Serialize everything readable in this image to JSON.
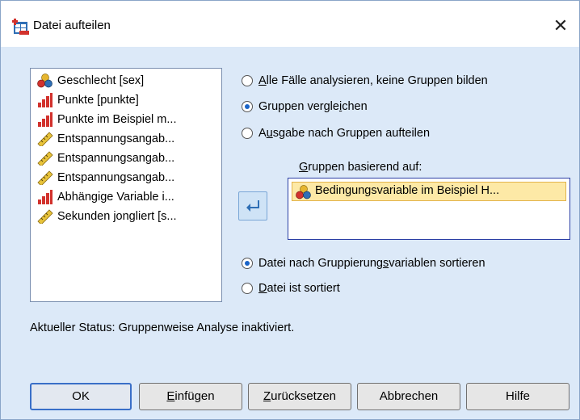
{
  "window": {
    "title": "Datei aufteilen",
    "close_glyph": "✕"
  },
  "variables": [
    {
      "label": "Geschlecht [sex]",
      "icon": "nominal-icon"
    },
    {
      "label": "Punkte [punkte]",
      "icon": "scale-icon"
    },
    {
      "label": "Punkte im Beispiel m...",
      "icon": "scale-icon"
    },
    {
      "label": "Entspannungsangab...",
      "icon": "ordinal-ruler-icon"
    },
    {
      "label": "Entspannungsangab...",
      "icon": "ordinal-ruler-icon"
    },
    {
      "label": "Entspannungsangab...",
      "icon": "ordinal-ruler-icon"
    },
    {
      "label": "Abhängige Variable i...",
      "icon": "scale-icon"
    },
    {
      "label": "Sekunden jongliert [s...",
      "icon": "ordinal-ruler-icon"
    }
  ],
  "analysis_options": [
    {
      "pre": "",
      "ul": "A",
      "post": "lle Fälle analysieren, keine Gruppen bilden",
      "selected": false
    },
    {
      "pre": "Gruppen vergle",
      "ul": "i",
      "post": "chen",
      "selected": true
    },
    {
      "pre": "A",
      "ul": "u",
      "post": "sgabe nach Gruppen aufteilen",
      "selected": false
    }
  ],
  "groups": {
    "label_ul": "G",
    "label_rest": "ruppen basierend auf:",
    "items": [
      {
        "label": "Bedingungsvariable im Beispiel H...",
        "icon": "nominal-icon"
      }
    ]
  },
  "sort_options": [
    {
      "pre": "Datei nach Gruppierung",
      "ul": "s",
      "post": "variablen sortieren",
      "selected": true
    },
    {
      "pre": "",
      "ul": "D",
      "post": "atei ist sortiert",
      "selected": false
    }
  ],
  "status": "Aktueller Status: Gruppenweise Analyse inaktiviert.",
  "buttons": {
    "ok": {
      "pre": "OK",
      "ul": "",
      "post": ""
    },
    "paste": {
      "pre": "",
      "ul": "E",
      "post": "infügen"
    },
    "reset": {
      "pre": "",
      "ul": "Z",
      "post": "urücksetzen"
    },
    "cancel": {
      "pre": "Abbrechen",
      "ul": "",
      "post": ""
    },
    "help": {
      "pre": "Hilfe",
      "ul": "",
      "post": ""
    }
  },
  "colors": {
    "dialog_bg": "#dce9f8",
    "selection_bg": "#fde9a6",
    "accent": "#1a64c8"
  }
}
